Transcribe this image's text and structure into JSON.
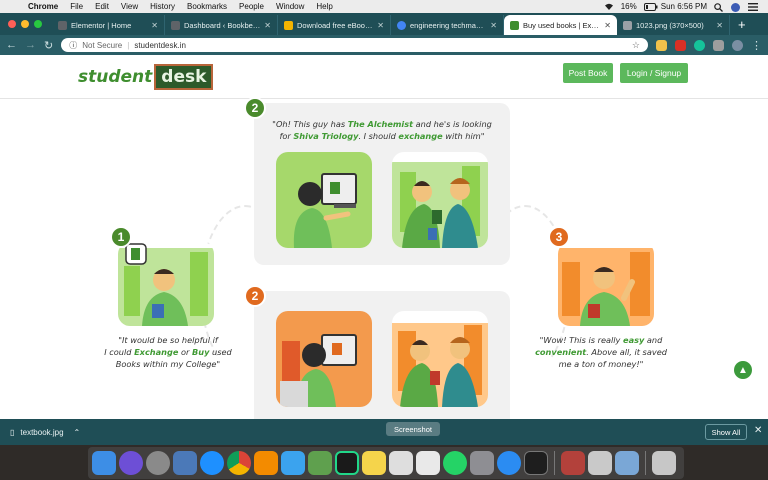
{
  "menubar": {
    "app": "Chrome",
    "items": [
      "File",
      "Edit",
      "View",
      "History",
      "Bookmarks",
      "People",
      "Window",
      "Help"
    ],
    "battery": "16%",
    "clock": "Sun 6:56 PM"
  },
  "tabs": [
    {
      "title": "Elementor | Home",
      "color": "#5f6368"
    },
    {
      "title": "Dashboard ‹ Bookbecho.",
      "color": "#5f6368"
    },
    {
      "title": "Download free eBooks a",
      "color": "#f4b400"
    },
    {
      "title": "engineering techmax boo",
      "color": "#4285f4"
    },
    {
      "title": "Buy used books | Exchang",
      "color": "#3f8e2f"
    },
    {
      "title": "1023.png (370×500)",
      "color": "#9aa0a6"
    }
  ],
  "address": {
    "security": "Not Secure",
    "url": "studentdesk.in"
  },
  "site": {
    "logo_a": "student",
    "logo_b": "desk",
    "post_label": "Post Book",
    "login_label": "Login / Signup",
    "steps": {
      "s1": {
        "num": "1",
        "q1": "\"It would be so helpful if",
        "q2a": "I could ",
        "q2b": "Exchange",
        "q2c": " or ",
        "q2d": "Buy",
        "q2e": " used",
        "q3": "Books within my College\""
      },
      "s2a": {
        "num": "2",
        "q1a": "\"Oh! This guy has ",
        "q1b": "The Alchemist",
        "q1c": " and he's is looking",
        "q2a": "for ",
        "q2b": "Shiva Triology",
        "q2c": ". I should ",
        "q2d": "exchange",
        "q2e": " with him\""
      },
      "s2b": {
        "num": "2"
      },
      "s3": {
        "num": "3",
        "q1": "\"Wow! This is really ",
        "q1b": "easy",
        "q1c": " and",
        "q2a": "convenient",
        "q2b": ". Above all, it saved",
        "q3": "me a ton of money!\""
      }
    }
  },
  "downloads": {
    "file": "textbook.jpg",
    "show_all": "Show All",
    "tooltip": "Screenshot"
  },
  "dock": [
    {
      "name": "finder-icon",
      "color": "#3d8ee6"
    },
    {
      "name": "siri-icon",
      "color": "#6d4fd6"
    },
    {
      "name": "launchpad-icon",
      "color": "#8a8a8a"
    },
    {
      "name": "preview-icon",
      "color": "#4b79b8"
    },
    {
      "name": "safari-icon",
      "color": "#1e90ff"
    },
    {
      "name": "chrome-icon",
      "color": "#db4437"
    },
    {
      "name": "sublime-icon",
      "color": "#f38b00"
    },
    {
      "name": "xcode-icon",
      "color": "#3ba3ee"
    },
    {
      "name": "android-studio-icon",
      "color": "#5fa04e"
    },
    {
      "name": "pycharm-icon",
      "color": "#21d789"
    },
    {
      "name": "notes-icon",
      "color": "#f5d44b"
    },
    {
      "name": "photos-icon",
      "color": "#dedede"
    },
    {
      "name": "screenshot-icon",
      "color": "#e9e9e9"
    },
    {
      "name": "whatsapp-icon",
      "color": "#25d366"
    },
    {
      "name": "system-preferences-icon",
      "color": "#8e8e93"
    },
    {
      "name": "app-store-icon",
      "color": "#2b8cf2"
    },
    {
      "name": "terminal-icon",
      "color": "#1e1e1e"
    },
    {
      "name": "dictionary-icon",
      "color": "#b3413b"
    },
    {
      "name": "sequel-pro-icon",
      "color": "#c9c9c9"
    },
    {
      "name": "image-capture-icon",
      "color": "#7aa7d6"
    },
    {
      "name": "trash-icon",
      "color": "#c7c7c7"
    }
  ]
}
